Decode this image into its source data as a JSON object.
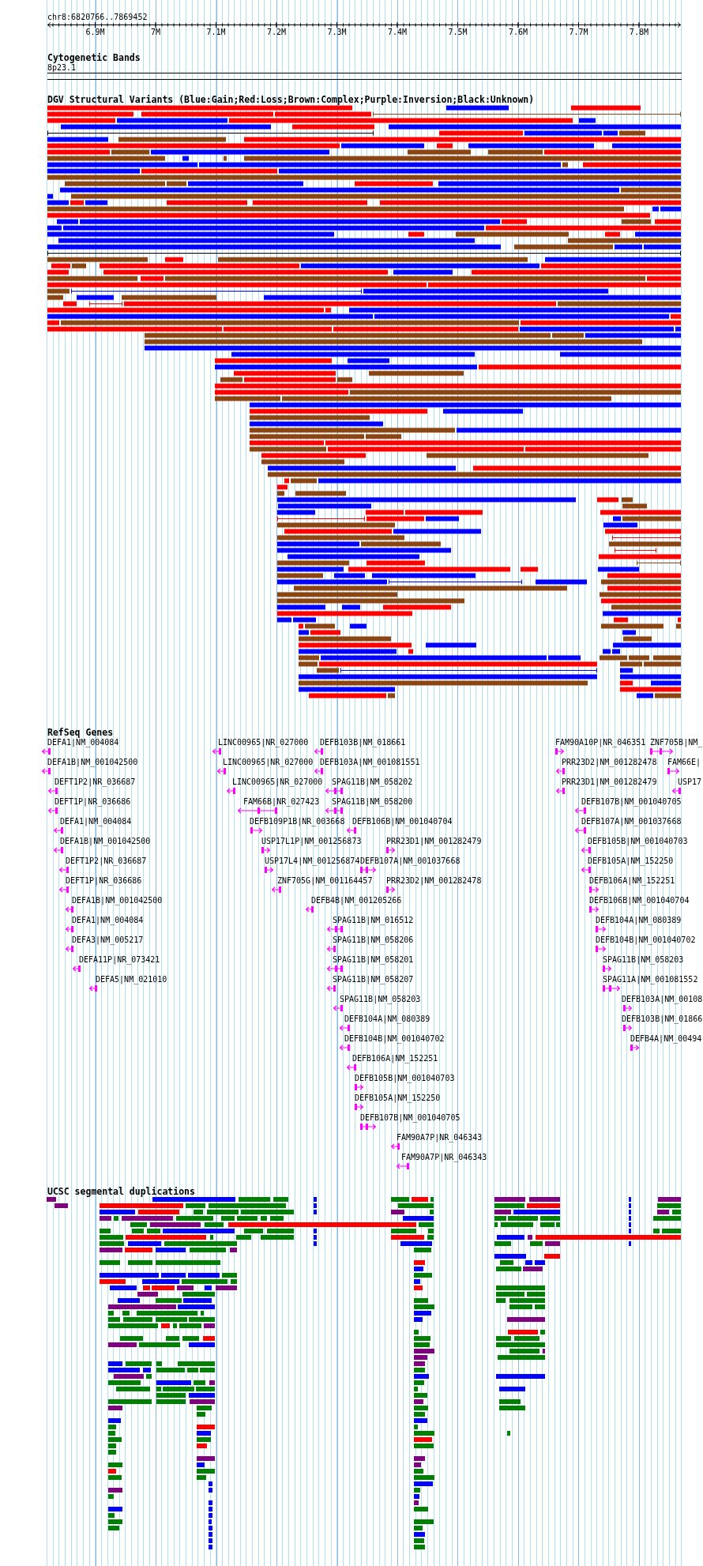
{
  "header": {
    "position": "chr8:6820766..7869452",
    "ruler_ticks": [
      "6.9M",
      "7M",
      "7.1M",
      "7.2M",
      "7.3M",
      "7.4M",
      "7.5M",
      "7.6M",
      "7.7M",
      "7.8M"
    ]
  },
  "cytoband_track": {
    "title": "Cytogenetic Bands",
    "band": "8p23.1"
  },
  "dgv_track": {
    "title": "DGV Structural Variants (Blue:Gain;Red:Loss;Brown:Complex;Purple:Inversion;Black:Unknown)"
  },
  "refseq_track": {
    "title": "RefSeq Genes",
    "genes": [
      {
        "label": "DEFA1|NM_004084",
        "reverse": true
      },
      {
        "label": "LINC00965|NR_027000",
        "reverse": true
      },
      {
        "label": "DEFB103B|NM_018661",
        "reverse": true
      },
      {
        "label": "FAM90A10P|NR_046351",
        "reverse": false
      },
      {
        "label": "ZNF705B|NM_",
        "reverse": false
      },
      {
        "label": "DEFA1B|NM_001042500",
        "reverse": true
      },
      {
        "label": "LINC00965|NR_027000",
        "reverse": true
      },
      {
        "label": "DEFB103A|NM_001081551",
        "reverse": true
      },
      {
        "label": "PRR23D2|NM_001282478",
        "reverse": true
      },
      {
        "label": "FAM66E|",
        "reverse": false
      },
      {
        "label": "DEFT1P2|NR_036687",
        "reverse": true
      },
      {
        "label": "LINC00965|NR_027000",
        "reverse": true
      },
      {
        "label": "SPAG11B|NM_058202",
        "reverse": true
      },
      {
        "label": "PRR23D1|NM_001282479",
        "reverse": true
      },
      {
        "label": "USP17",
        "reverse": true
      },
      {
        "label": "DEFT1P|NR_036686",
        "reverse": true
      },
      {
        "label": "FAM66B|NR_027423",
        "reverse": true
      },
      {
        "label": "SPAG11B|NM_058200",
        "reverse": true
      },
      {
        "label": "DEFB107B|NM_001040705",
        "reverse": true
      },
      {
        "label": "DEFA1|NM_004084",
        "reverse": true
      },
      {
        "label": "DEFB109P1B|NR_003668",
        "reverse": false
      },
      {
        "label": "DEFB106B|NM_001040704",
        "reverse": true
      },
      {
        "label": "DEFB107A|NM_001037668",
        "reverse": true
      },
      {
        "label": "DEFA1B|NM_001042500",
        "reverse": true
      },
      {
        "label": "USP17L1P|NM_001256873",
        "reverse": false
      },
      {
        "label": "PRR23D1|NM_001282479",
        "reverse": false
      },
      {
        "label": "DEFB105B|NM_001040703",
        "reverse": true
      },
      {
        "label": "DEFT1P2|NR_036687",
        "reverse": true
      },
      {
        "label": "USP17L4|NM_001256874",
        "reverse": false
      },
      {
        "label": "DEFB107A|NM_001037668",
        "reverse": false
      },
      {
        "label": "DEFB105A|NM_152250",
        "reverse": true
      },
      {
        "label": "DEFT1P|NR_036686",
        "reverse": true
      },
      {
        "label": "ZNF705G|NM_001164457",
        "reverse": true
      },
      {
        "label": "PRR23D2|NM_001282478",
        "reverse": false
      },
      {
        "label": "DEFB106A|NM_152251",
        "reverse": false
      },
      {
        "label": "DEFA1B|NM_001042500",
        "reverse": true
      },
      {
        "label": "DEFB4B|NM_001205266",
        "reverse": true
      },
      {
        "label": "DEFB106B|NM_001040704",
        "reverse": false
      },
      {
        "label": "DEFA1|NM_004084",
        "reverse": true
      },
      {
        "label": "SPAG11B|NM_016512",
        "reverse": true
      },
      {
        "label": "DEFB104A|NM_080389",
        "reverse": false
      },
      {
        "label": "DEFA3|NM_005217",
        "reverse": true
      },
      {
        "label": "SPAG11B|NM_058206",
        "reverse": true
      },
      {
        "label": "DEFB104B|NM_001040702",
        "reverse": false
      },
      {
        "label": "DEFA11P|NR_073421",
        "reverse": true
      },
      {
        "label": "SPAG11B|NM_058201",
        "reverse": true
      },
      {
        "label": "SPAG11B|NM_058203",
        "reverse": false
      },
      {
        "label": "DEFA5|NM_021010",
        "reverse": true
      },
      {
        "label": "SPAG11B|NM_058207",
        "reverse": true
      },
      {
        "label": "SPAG11A|NM_001081552",
        "reverse": false
      },
      {
        "label": "SPAG11B|NM_058203",
        "reverse": true
      },
      {
        "label": "DEFB103A|NM_00108",
        "reverse": false
      },
      {
        "label": "DEFB104A|NM_080389",
        "reverse": true
      },
      {
        "label": "DEFB103B|NM_01866",
        "reverse": false
      },
      {
        "label": "DEFB104B|NM_001040702",
        "reverse": true
      },
      {
        "label": "DEFB4A|NM_00494",
        "reverse": false
      },
      {
        "label": "DEFB106A|NM_152251",
        "reverse": true
      },
      {
        "label": "DEFB105B|NM_001040703",
        "reverse": false
      },
      {
        "label": "DEFB105A|NM_152250",
        "reverse": false
      },
      {
        "label": "DEFB107B|NM_001040705",
        "reverse": false
      },
      {
        "label": "FAM90A7P|NR_046343",
        "reverse": true
      },
      {
        "label": "FAM90A7P|NR_046343",
        "reverse": true
      }
    ]
  },
  "segdup_track": {
    "title": "UCSC segmental duplications"
  }
}
